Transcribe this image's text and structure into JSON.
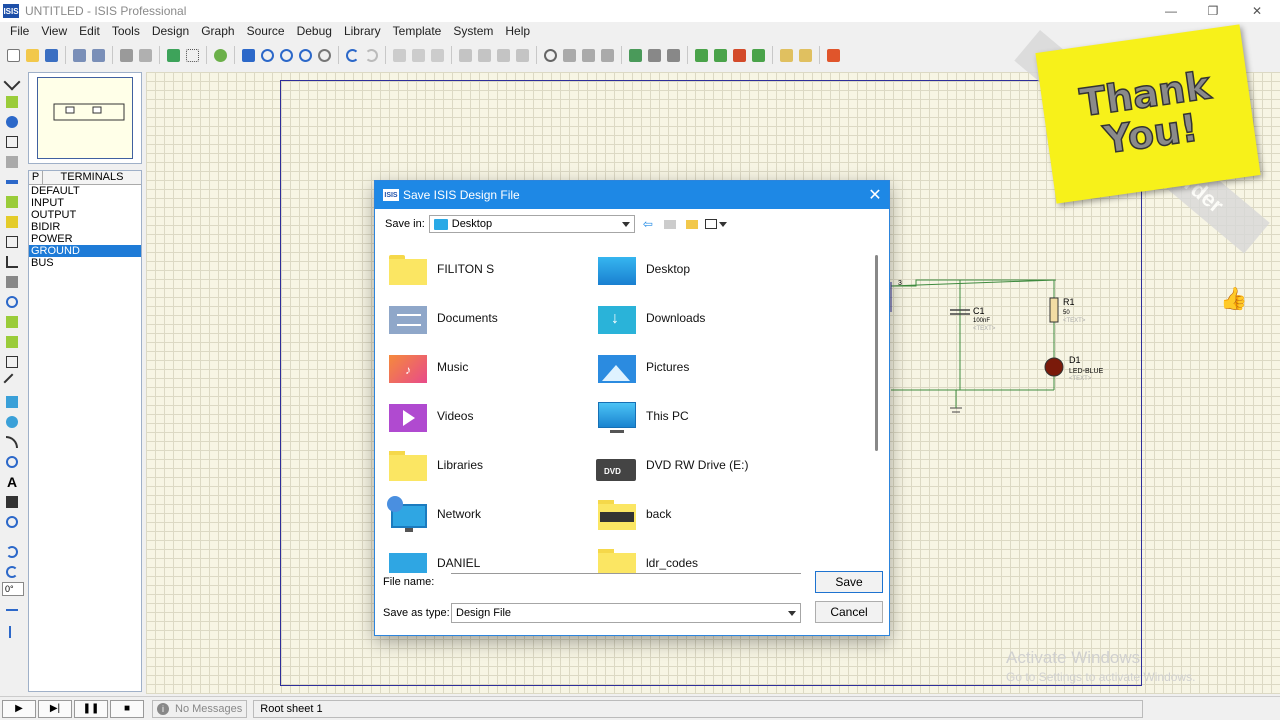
{
  "window": {
    "logo": "ISIS",
    "title": "UNTITLED - ISIS Professional",
    "controls": {
      "minimize": "—",
      "maximize": "❐",
      "close": "✕"
    }
  },
  "menu": [
    "File",
    "View",
    "Edit",
    "Tools",
    "Design",
    "Graph",
    "Source",
    "Debug",
    "Library",
    "Template",
    "System",
    "Help"
  ],
  "terminals": {
    "header_p": "P",
    "header_title": "TERMINALS",
    "items": [
      "DEFAULT",
      "INPUT",
      "OUTPUT",
      "BIDIR",
      "POWER",
      "GROUND",
      "BUS"
    ],
    "selected": "GROUND"
  },
  "rotation": "0°",
  "circuit": {
    "c1_ref": "C1",
    "c1_val": "100nF",
    "c1_text": "<TEXT>",
    "r1_ref": "R1",
    "r1_val": "50",
    "r1_text": "<TEXT>",
    "d1_ref": "D1",
    "d1_val": "LED-BLUE",
    "d1_text": "<TEXT>",
    "pin3": "3"
  },
  "sticky_note": {
    "line1": "Thank",
    "line2": "You!"
  },
  "ribbon": {
    "text1": "T",
    "text2": "rder"
  },
  "dialog": {
    "logo": "ISIS",
    "title": "Save ISIS Design File",
    "close": "✕",
    "save_in_label": "Save in:",
    "save_in_value": "Desktop",
    "files": [
      {
        "name": "FILITON S",
        "icon": "folder-icon"
      },
      {
        "name": "Desktop",
        "icon": "desktop-folder-icon"
      },
      {
        "name": "Documents",
        "icon": "documents-folder-icon"
      },
      {
        "name": "Downloads",
        "icon": "downloads-folder-icon"
      },
      {
        "name": "Music",
        "icon": "music-folder-icon"
      },
      {
        "name": "Pictures",
        "icon": "pictures-folder-icon"
      },
      {
        "name": "Videos",
        "icon": "videos-folder-icon"
      },
      {
        "name": "This PC",
        "icon": "pc-icon"
      },
      {
        "name": "Libraries",
        "icon": "folder-icon"
      },
      {
        "name": "DVD RW Drive (E:)",
        "icon": "dvd-drive-icon"
      },
      {
        "name": "Network",
        "icon": "network-icon"
      },
      {
        "name": "back",
        "icon": "folder-icon"
      },
      {
        "name": "DANIEL",
        "icon": "folder-icon"
      },
      {
        "name": "ldr_codes",
        "icon": "folder-icon"
      }
    ],
    "dvd_badge": "DVD",
    "file_name_label": "File name:",
    "file_name_value": "",
    "save_as_type_label": "Save as type:",
    "save_as_type_value": "Design File",
    "save_button": "Save",
    "cancel_button": "Cancel"
  },
  "status": {
    "play": "▶",
    "step": "▶|",
    "pause": "❚❚",
    "stop": "■",
    "info_icon": "i",
    "messages": "No Messages",
    "sheet": "Root sheet 1"
  },
  "watermark": {
    "line1": "Activate Windows",
    "line2": "Go to Settings to activate Windows."
  },
  "colors": {
    "accent": "#1e88e5",
    "selection": "#1e7bd7",
    "canvas": "#f7f5e4",
    "sticky": "#f7f11a"
  }
}
